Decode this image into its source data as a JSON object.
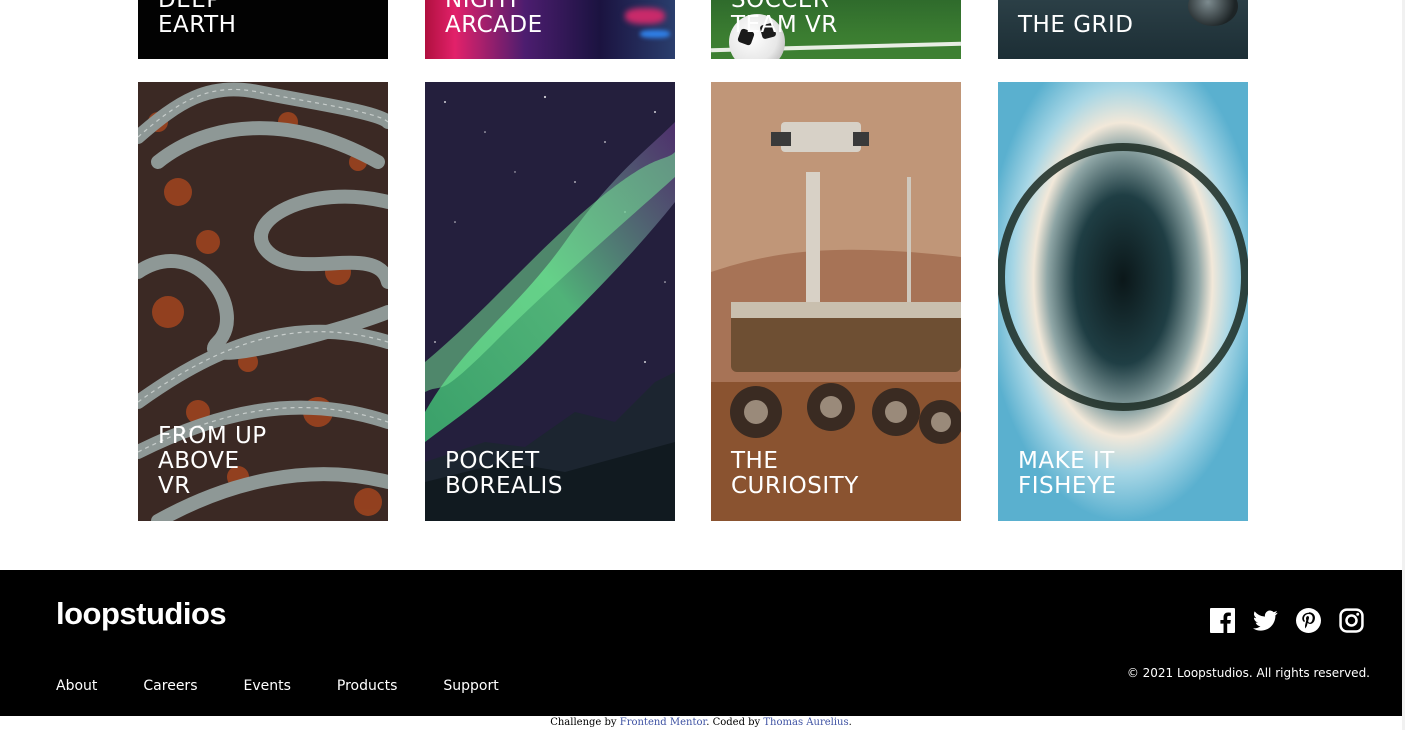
{
  "top_row": [
    {
      "title": "Deep\nEarth"
    },
    {
      "title": "Night\nArcade"
    },
    {
      "title": "Soccer\nTeam VR"
    },
    {
      "title": "The Grid"
    }
  ],
  "bottom_row": [
    {
      "title": "From up\nabove\nVR"
    },
    {
      "title": "Pocket\nBorealis"
    },
    {
      "title": "The\nCuriosity"
    },
    {
      "title": "Make it\nfisheye"
    }
  ],
  "footer": {
    "logo": "loopstudios",
    "nav": [
      "About",
      "Careers",
      "Events",
      "Products",
      "Support"
    ],
    "social": [
      "facebook-icon",
      "twitter-icon",
      "pinterest-icon",
      "instagram-icon"
    ],
    "copyright": "© 2021 Loopstudios. All rights reserved."
  },
  "attribution": {
    "prefix": "Challenge by ",
    "link1": "Frontend Mentor",
    "middle": ". Coded by ",
    "link2": "Thomas Aurelius",
    "suffix": "."
  },
  "colors": {
    "footer_bg": "#000000",
    "link": "#3e52a3"
  }
}
